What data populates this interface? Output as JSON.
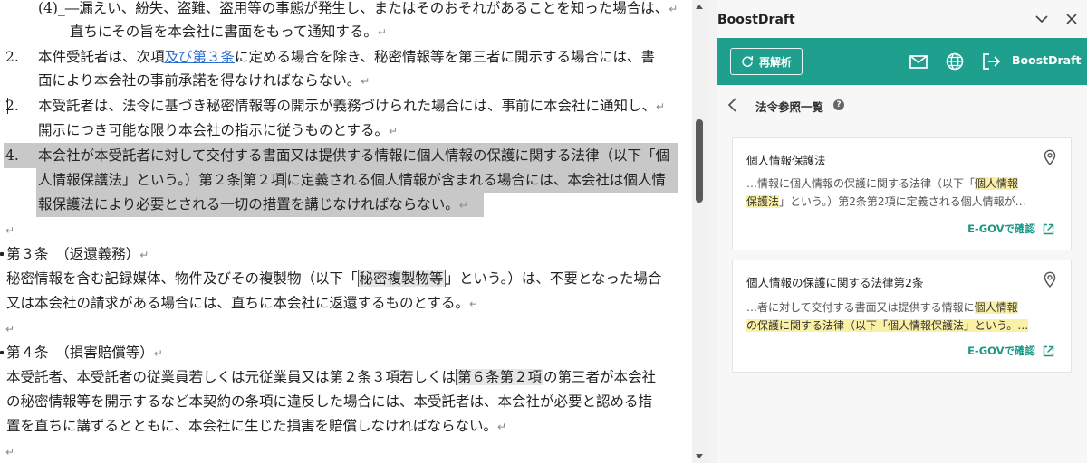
{
  "document": {
    "line1": "(4)_―漏えい、紛失、盗難、盗用等の事態が発生し、またはそのおそれがあることを知った場合は、",
    "line2": "直ちにその旨を本会社に書面をもって通知する。",
    "item2_num": "2.",
    "item2_a": "本件受託者は、次項",
    "item2_link": "及び第３条",
    "item2_b": "に定める場合を除き、秘密情報等を第三者に開示する場合には、書",
    "item2_line2": "面により本会社の事前承諾を得なければならない。",
    "item3_num": "2.",
    "item3_line1": "本受託者は、法令に基づき秘密情報等の開示が義務づけられた場合には、事前に本会社に通知し、",
    "item3_line2": "開示につき可能な限り本会社の指示に従うものとする。",
    "item4_num": "4.",
    "item4_line1": "本会社が本受託者に対して交付する書面又は提供する情報に個人情報の保護に関する法律（以下「個",
    "item4_line2a": "人情報保護法」という。）第２条",
    "item4_line2_boxed": "第２項",
    "item4_line2b": "に定義される個人情報が含まれる場合には、本会社は個人情",
    "item4_line3": "報保護法により必要とされる一切の措置を講じなければならない。",
    "art3_title": "第３条　（返還義務）",
    "art3_line1a": "秘密情報を含む記録媒体、物件及びその複製物（以下「",
    "art3_line1_boxed": "秘密複製物等",
    "art3_line1b": "」という。）は、不要となった場合",
    "art3_line2": "又は本会社の請求がある場合には、直ちに本会社に返還するものとする。",
    "art4_title": "第４条　（損害賠償等）",
    "art4_line1a": "本受託者、本受託者の従業員若しくは元従業員又は第２条３項若しくは",
    "art4_line1_boxed": "第６条第２項",
    "art4_line1b": "の第三者が本会社",
    "art4_line2": "の秘密情報等を開示するなど本契約の条項に違反した場合には、本受託者は、本会社が必要と認める措",
    "art4_line3": "置を直ちに講ずるとともに、本会社に生じた損害を賠償しなければならない。",
    "para_mark": "↵"
  },
  "panel": {
    "title": "BoostDraft",
    "reanalyze_label": "再解析",
    "brand_label": "BoostDraft",
    "list_title": "法令参照一覧",
    "help_glyph": "?",
    "accent_color": "#1f9f8e",
    "highlight_color": "#fbf1a6",
    "cards": [
      {
        "title": "個人情報保護法",
        "snippet1_a": "…情報に個人情報の保護に関する法律（以下「",
        "snippet1_mark": "個人情報",
        "snippet2_mark": "保護法",
        "snippet2_b": "」という。）第2条第2項に定義される個人情報が…",
        "link": "E-GOVで確認"
      },
      {
        "title": "個人情報の保護に関する法律第2条",
        "snippet1_a": "…者に対して交付する書面又は提供する情報に",
        "snippet1_mark": "個人情報",
        "snippet2_mark": "の保護に関する法律（以下「個人情報保護法」という。…",
        "snippet2_b": "",
        "link": "E-GOVで確認"
      }
    ]
  },
  "icons": {
    "reanalyze": "refresh-icon",
    "mail": "mail-icon",
    "globe": "globe-icon",
    "logout": "logout-icon",
    "back": "chevron-left-icon",
    "pin": "location-pin-icon",
    "external": "external-link-icon",
    "collapse": "chevron-down-icon",
    "close": "close-icon"
  }
}
